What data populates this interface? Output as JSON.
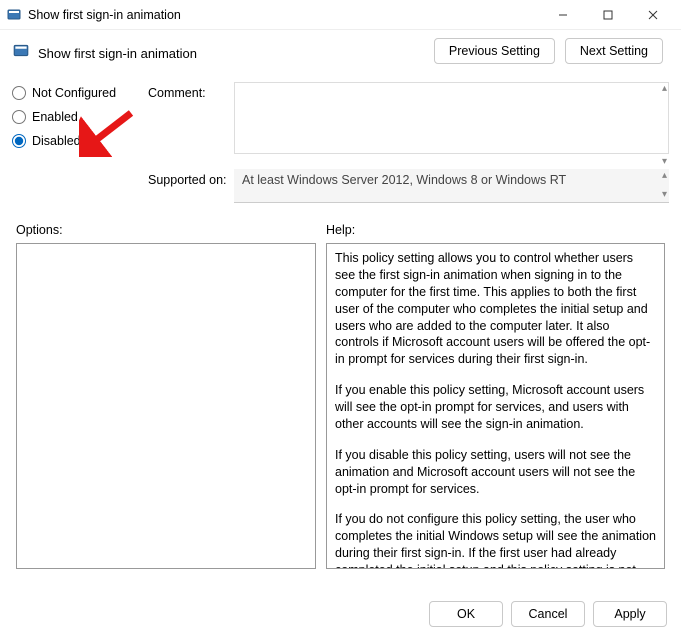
{
  "window": {
    "title": "Show first sign-in animation"
  },
  "header": {
    "policy_title": "Show first sign-in animation",
    "previous": "Previous Setting",
    "next": "Next Setting"
  },
  "radios": {
    "not_configured": "Not Configured",
    "enabled": "Enabled",
    "disabled": "Disabled"
  },
  "labels": {
    "comment": "Comment:",
    "supported": "Supported on:",
    "options": "Options:",
    "help": "Help:"
  },
  "fields": {
    "comment": "",
    "supported": "At least Windows Server 2012, Windows 8 or Windows RT"
  },
  "help": {
    "p1": "This policy setting allows you to control whether users see the first sign-in animation when signing in to the computer for the first time.  This applies to both the first user of the computer who completes the initial setup and users who are added to the computer later.  It also controls if Microsoft account users will be offered the opt-in prompt for services during their first sign-in.",
    "p2": "If you enable this policy setting, Microsoft account users will see the opt-in prompt for services, and users with other accounts will see the sign-in animation.",
    "p3": "If you disable this policy setting, users will not see the animation and Microsoft account users will not see the opt-in prompt for services.",
    "p4": "If you do not configure this policy setting, the user who completes the initial Windows setup will see the animation during their first sign-in. If the first user had already completed the initial setup and this policy setting is not configured, users new to this computer will not see the animation."
  },
  "buttons": {
    "ok": "OK",
    "cancel": "Cancel",
    "apply": "Apply"
  }
}
